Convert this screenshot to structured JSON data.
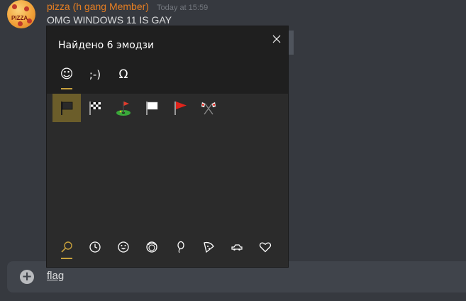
{
  "message": {
    "username": "pizza (h gang Member)",
    "timestamp": "Today at 15:59",
    "text": "OMG WINDOWS 11 IS GAY",
    "avatar_text": "PIZZA"
  },
  "input": {
    "value": "flag"
  },
  "emoji_panel": {
    "title": "Найдено 6 эмодзи",
    "tabs": [
      {
        "label": "☺",
        "name": "emoji"
      },
      {
        "label": ";-)",
        "name": "kaomoji"
      },
      {
        "label": "Ω",
        "name": "symbols"
      }
    ],
    "results": [
      {
        "name": "black-flag"
      },
      {
        "name": "chequered-flag"
      },
      {
        "name": "flag-in-hole"
      },
      {
        "name": "white-flag"
      },
      {
        "name": "triangular-flag"
      },
      {
        "name": "crossed-flags"
      }
    ],
    "categories": [
      {
        "icon": "search-icon"
      },
      {
        "icon": "clock-icon"
      },
      {
        "icon": "smiley-icon"
      },
      {
        "icon": "people-icon"
      },
      {
        "icon": "balloon-icon"
      },
      {
        "icon": "pizza-icon"
      },
      {
        "icon": "car-icon"
      },
      {
        "icon": "heart-icon"
      }
    ]
  },
  "colors": {
    "username": "#e67e22",
    "accent": "#c8a13d",
    "selected_cell": "#6b5d2a"
  }
}
